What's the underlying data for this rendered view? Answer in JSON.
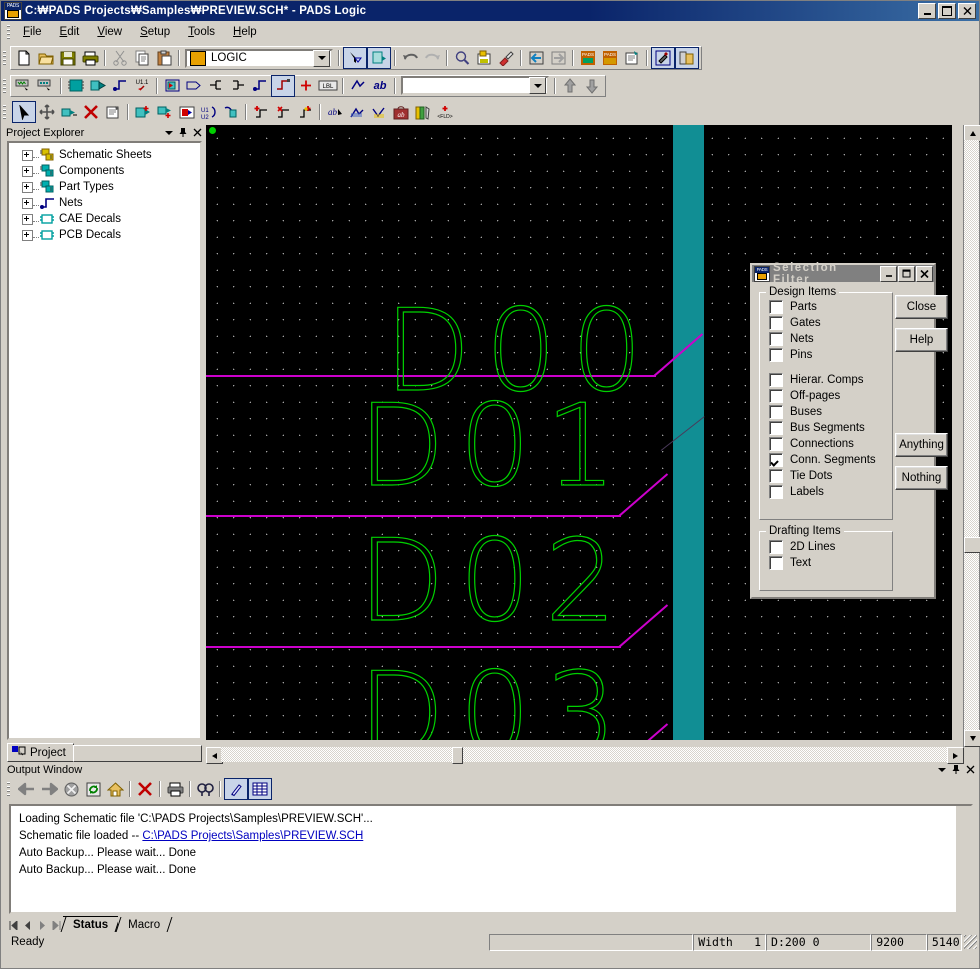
{
  "window": {
    "title": "C:₩PADS Projects₩Samples₩PREVIEW.SCH* - PADS Logic",
    "icon": "pads-app-icon",
    "minimize": "minimize-icon",
    "maximize": "maximize-icon",
    "close": "close-icon"
  },
  "menu": {
    "items": [
      "File",
      "Edit",
      "View",
      "Setup",
      "Tools",
      "Help"
    ]
  },
  "toolbar_standard": {
    "design_name": "LOGIC",
    "buttons": [
      {
        "name": "new-file-icon",
        "glyph": "⬜"
      },
      {
        "name": "open-file-icon",
        "glyph": "📂"
      },
      {
        "name": "save-file-icon",
        "glyph": "💾"
      },
      {
        "name": "print-icon",
        "glyph": "🖨"
      },
      {
        "name": "cut-icon",
        "glyph": "✂"
      },
      {
        "name": "copy-icon",
        "glyph": "⧉"
      },
      {
        "name": "paste-icon",
        "glyph": "📋"
      },
      {
        "name": "selection-filter-icon",
        "glyph": "➤"
      },
      {
        "name": "select-next-icon",
        "glyph": "➤"
      },
      {
        "name": "undo-icon",
        "glyph": "↶"
      },
      {
        "name": "redo-icon",
        "glyph": "↷"
      },
      {
        "name": "zoom-icon",
        "glyph": "🔍"
      },
      {
        "name": "view-board-icon",
        "glyph": "▣"
      },
      {
        "name": "redraw-icon",
        "glyph": "🖌"
      },
      {
        "name": "back-transfer-icon",
        "glyph": "⇦"
      },
      {
        "name": "forward-transfer-icon",
        "glyph": "⇨"
      },
      {
        "name": "pads-layout-icon",
        "glyph": "PADS"
      },
      {
        "name": "pads-router-icon",
        "glyph": "PADS"
      },
      {
        "name": "library-icon",
        "glyph": "☰"
      },
      {
        "name": "design-toolbar-icon",
        "glyph": "⚒"
      },
      {
        "name": "project-explorer-icon",
        "glyph": "🗂"
      }
    ]
  },
  "toolbar_design": {
    "find_value": "",
    "find_placeholder": "",
    "buttons": [
      {
        "name": "select-net-icon"
      },
      {
        "name": "select-anything-icon"
      },
      {
        "name": "add-part-icon"
      },
      {
        "name": "add-connection-icon"
      },
      {
        "name": "add-net-icon"
      },
      {
        "name": "rename-net-icon"
      },
      {
        "name": "add-hierarchical-comp-icon"
      },
      {
        "name": "add-off-page-icon"
      },
      {
        "name": "add-bus-icon"
      },
      {
        "name": "add-bus-segment-icon"
      },
      {
        "name": "add-connection-segment-icon"
      },
      {
        "name": "add-conn-segment-active-icon"
      },
      {
        "name": "add-tie-dot-icon"
      },
      {
        "name": "add-label-icon"
      },
      {
        "name": "add-2d-line-icon"
      },
      {
        "name": "add-text-icon"
      }
    ]
  },
  "toolbar_edit": {
    "buttons": [
      {
        "name": "select-pointer-icon"
      },
      {
        "name": "move-icon"
      },
      {
        "name": "rotate-icon"
      },
      {
        "name": "delete-icon"
      },
      {
        "name": "properties-icon"
      },
      {
        "name": "add-part-edit-icon"
      },
      {
        "name": "add-connection-edit-icon"
      },
      {
        "name": "add-sheet-icon"
      },
      {
        "name": "swap-refdes-icon"
      },
      {
        "name": "swap-gates-icon"
      },
      {
        "name": "add-segment-icon"
      },
      {
        "name": "delete-segment-icon"
      },
      {
        "name": "add-tiedot-icon"
      },
      {
        "name": "edit-label-icon"
      },
      {
        "name": "edit-2d-line-icon"
      },
      {
        "name": "edit-text-icon"
      },
      {
        "name": "attributes-icon"
      },
      {
        "name": "library-edit-icon"
      },
      {
        "name": "add-field-icon"
      }
    ]
  },
  "project_explorer": {
    "title": "Project Explorer",
    "dropdown_icon": "chevron-down-icon",
    "pin_icon": "pin-icon",
    "close_icon": "close-icon",
    "items": [
      {
        "label": "Schematic Sheets",
        "icon": "schematic-sheets-icon"
      },
      {
        "label": "Components",
        "icon": "components-icon"
      },
      {
        "label": "Part Types",
        "icon": "part-types-icon"
      },
      {
        "label": "Nets",
        "icon": "nets-icon"
      },
      {
        "label": "CAE Decals",
        "icon": "cae-decals-icon"
      },
      {
        "label": "PCB Decals",
        "icon": "pcb-decals-icon"
      }
    ],
    "tab_label": "Project",
    "tab_icon": "project-icon"
  },
  "canvas": {
    "background": "#000000",
    "grid_color": "#d8d8d8",
    "net_label_color": "#00d000",
    "bus_color": "#cc00cc",
    "bus_bar_color": "#118e94",
    "origin_marker": "origin-dot",
    "net_labels": [
      "D00",
      "D01",
      "D02",
      "D03"
    ]
  },
  "selection_filter": {
    "title": "Selection Filter",
    "icon": "pads-dialog-icon",
    "minimize": "minimize-icon",
    "maximize": "maximize-icon",
    "close": "close-icon",
    "design_items_legend": "Design Items",
    "design_items": [
      {
        "label": "Parts",
        "checked": false
      },
      {
        "label": "Gates",
        "checked": false
      },
      {
        "label": "Nets",
        "checked": false
      },
      {
        "label": "Pins",
        "checked": false
      },
      {
        "label": "Hierar. Comps",
        "checked": false,
        "gap": true
      },
      {
        "label": "Off-pages",
        "checked": false
      },
      {
        "label": "Buses",
        "checked": false
      },
      {
        "label": "Bus Segments",
        "checked": false
      },
      {
        "label": "Connections",
        "checked": false
      },
      {
        "label": "Conn. Segments",
        "checked": true
      },
      {
        "label": "Tie Dots",
        "checked": false
      },
      {
        "label": "Labels",
        "checked": false
      }
    ],
    "drafting_items_legend": "Drafting Items",
    "drafting_items": [
      {
        "label": "2D Lines",
        "checked": false
      },
      {
        "label": "Text",
        "checked": false
      }
    ],
    "buttons": {
      "close": "Close",
      "help": "Help",
      "anything": "Anything",
      "nothing": "Nothing"
    }
  },
  "output_window": {
    "title": "Output Window",
    "dropdown_icon": "chevron-down-icon",
    "pin_icon": "pin-icon",
    "close_icon": "close-icon",
    "toolbar": [
      {
        "name": "back-icon"
      },
      {
        "name": "forward-icon"
      },
      {
        "name": "stop-icon"
      },
      {
        "name": "refresh-icon"
      },
      {
        "name": "home-icon"
      },
      {
        "name": "clear-icon"
      },
      {
        "name": "print-icon"
      },
      {
        "name": "find-icon"
      },
      {
        "name": "edit-icon"
      },
      {
        "name": "grid-view-icon"
      }
    ],
    "lines": [
      {
        "text": "Loading Schematic file 'C:\\PADS Projects\\Samples\\PREVIEW.SCH'...",
        "link": ""
      },
      {
        "text": "Schematic file loaded -- ",
        "link": "C:\\PADS Projects\\Samples\\PREVIEW.SCH"
      },
      {
        "text": "Auto Backup... Please wait... Done",
        "link": ""
      },
      {
        "text": "Auto Backup... Please wait... Done",
        "link": ""
      }
    ],
    "tabs": [
      {
        "label": "Status",
        "active": true
      },
      {
        "label": "Macro",
        "active": false
      }
    ],
    "nav": [
      "first-icon",
      "previous-icon",
      "next-icon",
      "last-icon"
    ]
  },
  "status_bar": {
    "ready": "Ready",
    "blank": "",
    "width_label": "Width",
    "width_value": "1",
    "design_coords": "D:200 0",
    "x_coord": "9200",
    "y_coord": "5140",
    "resize_grip": "resize-grip-icon"
  }
}
